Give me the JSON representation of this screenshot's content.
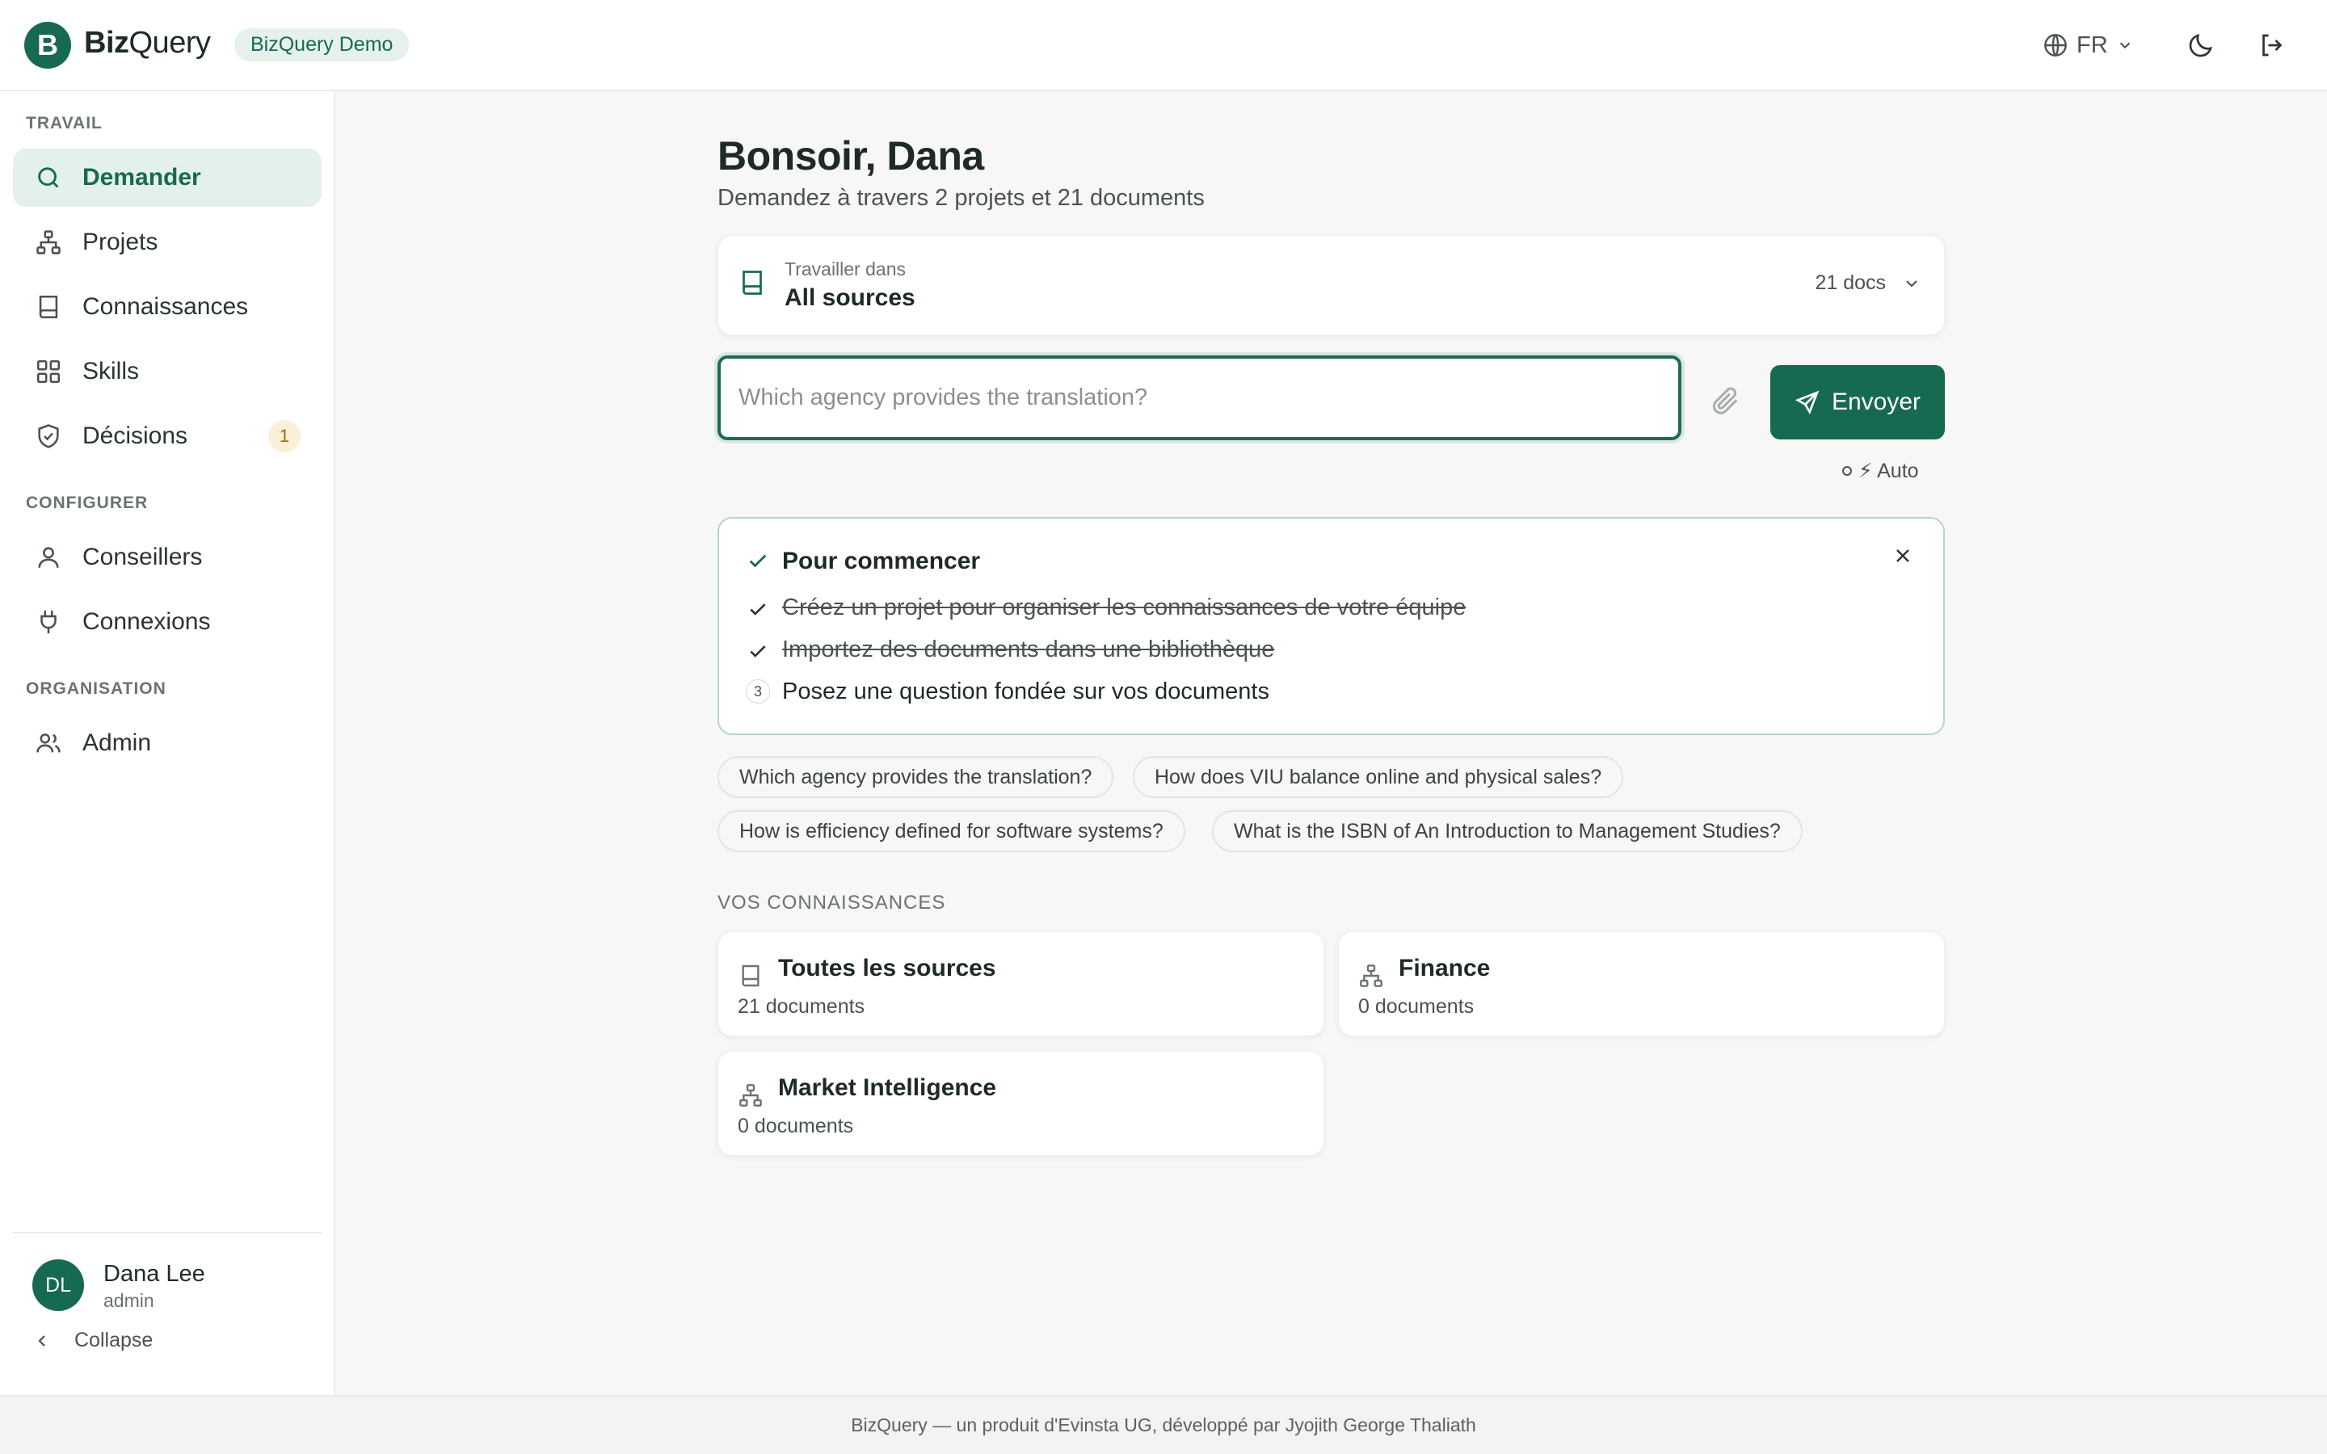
{
  "header": {
    "logo_letter": "B",
    "brand_biz": "Biz",
    "brand_query": "Query",
    "demo_badge": "BizQuery Demo",
    "language": "FR"
  },
  "sidebar": {
    "sections": {
      "work": "TRAVAIL",
      "configure": "CONFIGURER",
      "org": "ORGANISATION"
    },
    "items": [
      {
        "label": "Demander",
        "icon": "search-icon"
      },
      {
        "label": "Projets",
        "icon": "hierarchy-icon"
      },
      {
        "label": "Connaissances",
        "icon": "book-icon"
      },
      {
        "label": "Skills",
        "icon": "grid-icon"
      },
      {
        "label": "Décisions",
        "icon": "shield-check-icon",
        "badge": "1"
      },
      {
        "label": "Conseillers",
        "icon": "user-icon"
      },
      {
        "label": "Connexions",
        "icon": "plug-icon"
      },
      {
        "label": "Admin",
        "icon": "users-icon"
      }
    ],
    "user": {
      "initials": "DL",
      "name": "Dana Lee",
      "role": "admin"
    },
    "collapse_label": "Collapse"
  },
  "main": {
    "greeting": "Bonsoir, Dana",
    "subtitle": "Demandez à travers 2 projets et 21 documents",
    "workspace": {
      "label": "Travailler dans",
      "value": "All sources",
      "count": "21 docs"
    },
    "query": {
      "placeholder": "Which agency provides the translation?",
      "value": ""
    },
    "send_label": "Envoyer",
    "mode": "⚡ Auto",
    "getting_started": {
      "title": "Pour commencer",
      "steps": [
        {
          "text": "Créez un projet pour organiser les connaissances de votre équipe",
          "done": true
        },
        {
          "text": "Importez des documents dans une bibliothèque",
          "done": true
        },
        {
          "text": "Posez une question fondée sur vos documents",
          "done": false,
          "number": "3"
        }
      ]
    },
    "suggestions": [
      "Which agency provides the translation?",
      "How does VIU balance online and physical sales?",
      "How is efficiency defined for software systems?",
      "What is the ISBN of An Introduction to Management Studies?"
    ],
    "knowledge_label": "VOS CONNAISSANCES",
    "knowledge": [
      {
        "name": "Toutes les sources",
        "docs": "21 documents",
        "icon": "book-icon"
      },
      {
        "name": "Finance",
        "docs": "0 documents",
        "icon": "hierarchy-icon"
      },
      {
        "name": "Market Intelligence",
        "docs": "0 documents",
        "icon": "hierarchy-icon"
      }
    ]
  },
  "footer": "BizQuery — un produit d'Evinsta UG, développé par Jyojith George Thaliath",
  "colors": {
    "accent": "#176a52",
    "accent_light": "#e4f0eb",
    "badge_bg": "#fbefd9"
  }
}
